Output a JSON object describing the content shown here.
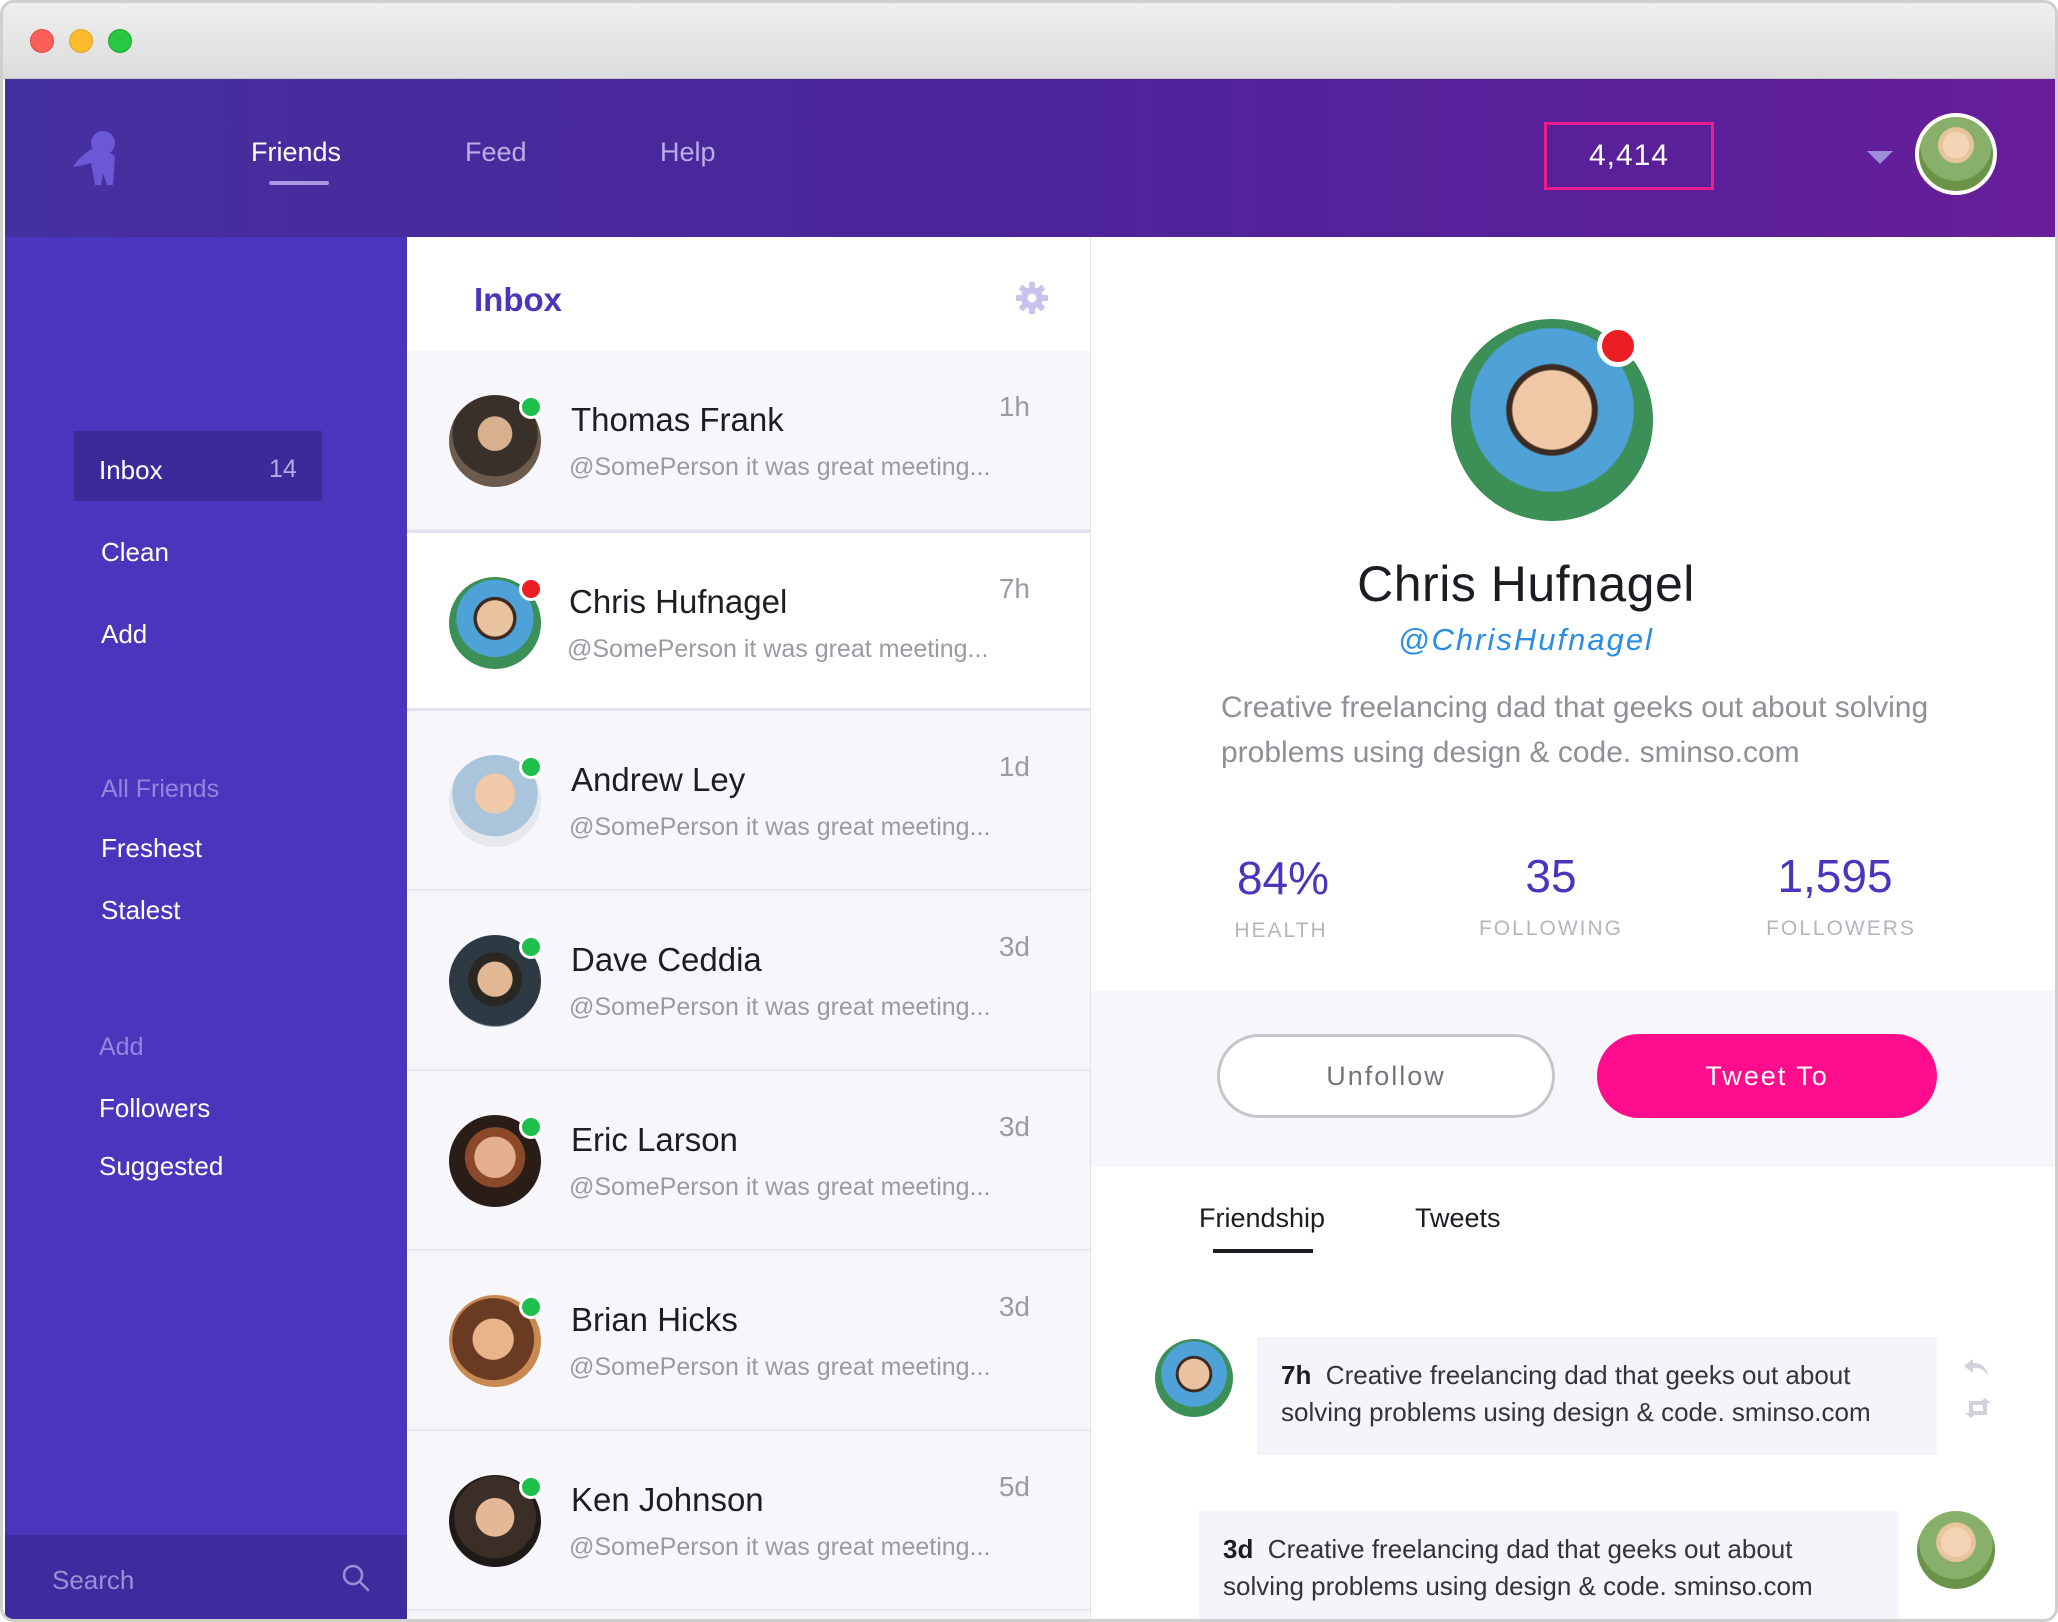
{
  "window": {
    "controls": [
      "close",
      "minimize",
      "zoom"
    ]
  },
  "header": {
    "nav": [
      {
        "label": "Friends",
        "active": true
      },
      {
        "label": "Feed",
        "active": false
      },
      {
        "label": "Help",
        "active": false
      }
    ],
    "counter": "4,414",
    "logo_icon": "mascot-logo-icon",
    "accent": "#4a35bd",
    "highlight": "#ec1e8a"
  },
  "sidebar": {
    "items": [
      {
        "label": "Inbox",
        "count": "14",
        "active": true
      },
      {
        "label": "Clean"
      },
      {
        "label": "Add"
      }
    ],
    "sections": [
      {
        "heading": "All Friends",
        "items": [
          "Freshest",
          "Stalest"
        ]
      },
      {
        "heading": "Add",
        "items": [
          "Followers",
          "Suggested"
        ]
      }
    ],
    "search": {
      "placeholder": "Search",
      "icon": "search-icon"
    }
  },
  "inbox": {
    "title": "Inbox",
    "settings_icon": "gear-icon",
    "rows": [
      {
        "name": "Thomas Frank",
        "message": "@SomePerson it was great meeting...",
        "time": "1h",
        "status": "online"
      },
      {
        "name": "Chris Hufnagel",
        "message": "@SomePerson it was great meeting...",
        "time": "7h",
        "status": "alert",
        "selected": true
      },
      {
        "name": "Andrew Ley",
        "message": "@SomePerson it was great meeting...",
        "time": "1d",
        "status": "online"
      },
      {
        "name": "Dave Ceddia",
        "message": "@SomePerson it was great meeting...",
        "time": "3d",
        "status": "online"
      },
      {
        "name": "Eric Larson",
        "message": "@SomePerson it was great meeting...",
        "time": "3d",
        "status": "online"
      },
      {
        "name": "Brian Hicks",
        "message": "@SomePerson it was great meeting...",
        "time": "3d",
        "status": "online"
      },
      {
        "name": "Ken Johnson",
        "message": "@SomePerson it was great meeting...",
        "time": "5d",
        "status": "online"
      }
    ]
  },
  "profile": {
    "name": "Chris Hufnagel",
    "handle": "@ChrisHufnagel",
    "bio": "Creative freelancing dad that geeks out about solving problems using design & code. sminso.com",
    "stats": [
      {
        "value": "84%",
        "label": "HEALTH"
      },
      {
        "value": "35",
        "label": "FOLLOWING"
      },
      {
        "value": "1,595",
        "label": "FOLLOWERS"
      }
    ],
    "actions": {
      "unfollow": "Unfollow",
      "tweet": "Tweet To"
    },
    "tabs": [
      {
        "label": "Friendship",
        "active": true
      },
      {
        "label": "Tweets",
        "active": false
      }
    ],
    "feed": [
      {
        "time": "7h",
        "text": "Creative freelancing dad that geeks out about solving problems using design & code. sminso.com"
      },
      {
        "time": "3d",
        "text": "Creative freelancing dad that geeks out about solving problems using design & code. sminso.com"
      }
    ]
  }
}
